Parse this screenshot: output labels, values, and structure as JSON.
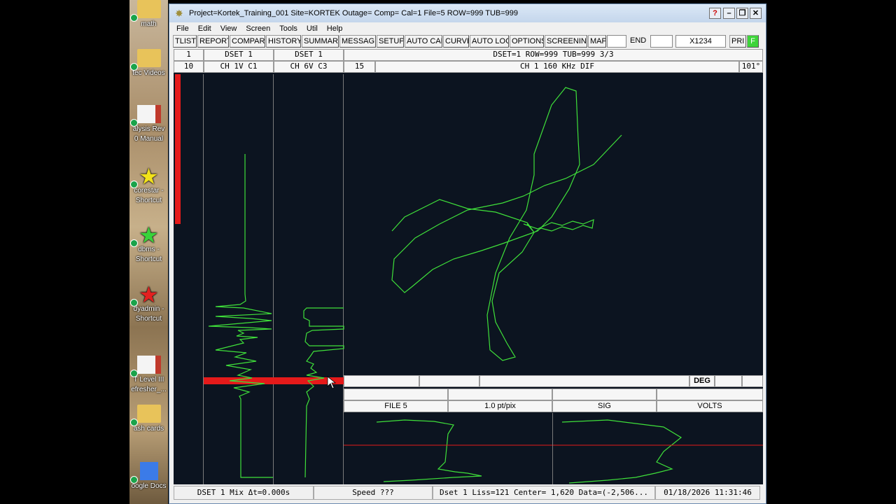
{
  "desktop": {
    "icons": [
      {
        "label": "math",
        "color": "#e8c35a",
        "kind": "folder-icon"
      },
      {
        "label": "tec Videos",
        "color": "#e8c35a",
        "kind": "folder-icon"
      },
      {
        "label": "alysis Rev\n0 Manual",
        "color": "#c0392b",
        "kind": "pdf-icon"
      },
      {
        "label": "corestar -\nShortcut",
        "color": "#f2e21a",
        "kind": "star-icon"
      },
      {
        "label": "dbms -\nShortcut",
        "color": "#39d33a",
        "kind": "star-icon"
      },
      {
        "label": "dyadmin -\nShortcut",
        "color": "#e32020",
        "kind": "star-icon"
      },
      {
        "label": "T Level III\nefresher_...",
        "color": "#c0392b",
        "kind": "pdf-icon"
      },
      {
        "label": "ash cards",
        "color": "#e8c35a",
        "kind": "folder-icon"
      },
      {
        "label": "oogle Docs",
        "color": "#3b7be8",
        "kind": "doc-icon"
      }
    ]
  },
  "window": {
    "title": "Project=Kortek_Training_001  Site=KORTEK  Outage=  Comp=  Cal=1  File=5  ROW=999  TUB=999",
    "controls": [
      "?",
      "–",
      "❐",
      "✕"
    ]
  },
  "menu": [
    "File",
    "Edit",
    "View",
    "Screen",
    "Tools",
    "Util",
    "Help"
  ],
  "toolbar": {
    "buttons": [
      "TLIST",
      "REPORT",
      "COMPARE",
      "HISTORY",
      "SUMMARY",
      "MESSAGE",
      "SETUP",
      "AUTO CAL",
      "CURVE",
      "AUTO LOC",
      "OPTIONS",
      "SCREENING (",
      "MAP"
    ],
    "end_label": "END",
    "x_field": "X1234",
    "pri_label": "PRI",
    "f_label": "F"
  },
  "strips": {
    "row1": [
      "1",
      "DSET 1",
      "DSET 1"
    ],
    "row2": [
      "10",
      "CH 1V C1",
      "CH 6V C3"
    ]
  },
  "lissajous": {
    "info": "DSET=1 ROW=999 TUB=999 3/3",
    "span": "15",
    "channel": "CH 1 160 KHz DIF",
    "angle": "101°"
  },
  "lower": {
    "deg_label": "DEG",
    "file_label": "FILE 5",
    "scale_label": "1.0 pt/pix",
    "sig_label": "SIG",
    "units_label": "VOLTS"
  },
  "status": {
    "mix": "DSET 1 Mix Δt=0.000s",
    "speed": "Speed ???",
    "liss": "Dset 1 Liss=121 Center= 1,620 Data=(-2,506...",
    "datetime": "01/18/2026 11:31:46"
  },
  "colors": {
    "trace": "#3fe03a",
    "marker": "#e51a1a",
    "background": "#0c1420"
  }
}
